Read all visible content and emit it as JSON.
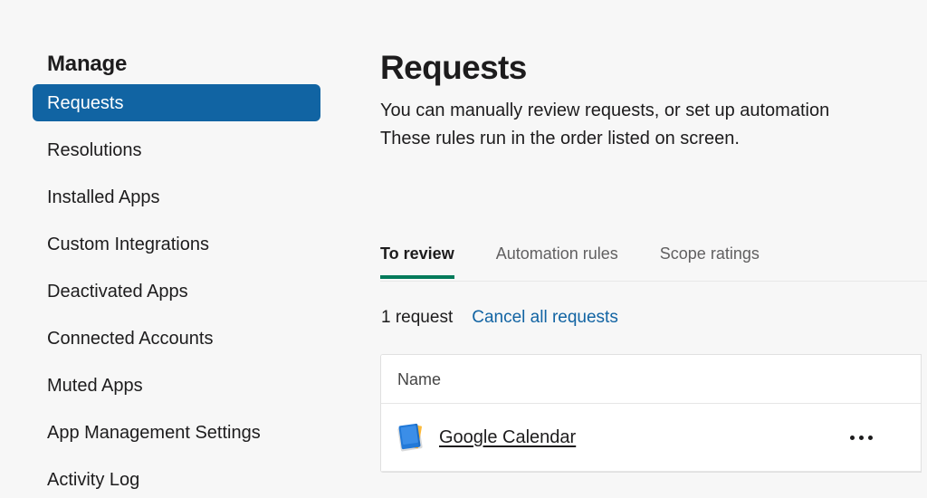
{
  "colors": {
    "page_background": "#f7f7f7",
    "sidebar_selected_background": "#1164a3",
    "sidebar_selected_text": "#ffffff",
    "active_tab_underline": "#007a5a",
    "link_blue": "#1264a3",
    "text_primary": "#1d1c1d",
    "text_muted": "#616061",
    "card_background": "#ffffff",
    "card_border": "#e0e0e0"
  },
  "sidebar": {
    "heading": "Manage",
    "items": [
      {
        "label": "Requests",
        "selected": true
      },
      {
        "label": "Resolutions",
        "selected": false
      },
      {
        "label": "Installed Apps",
        "selected": false
      },
      {
        "label": "Custom Integrations",
        "selected": false
      },
      {
        "label": "Deactivated Apps",
        "selected": false
      },
      {
        "label": "Connected Accounts",
        "selected": false
      },
      {
        "label": "Muted Apps",
        "selected": false
      },
      {
        "label": "App Management Settings",
        "selected": false
      },
      {
        "label": "Activity Log",
        "selected": false
      }
    ]
  },
  "main": {
    "title": "Requests",
    "description_line1": "You can manually review requests, or set up automation",
    "description_line2": "These rules run in the order listed on screen.",
    "tabs": [
      {
        "label": "To review",
        "active": true
      },
      {
        "label": "Automation rules",
        "active": false
      },
      {
        "label": "Scope ratings",
        "active": false
      }
    ],
    "meta": {
      "count_label": "1 request",
      "cancel_all_label": "Cancel all requests"
    },
    "table": {
      "columns": [
        "Name"
      ],
      "rows": [
        {
          "name": "Google Calendar",
          "icon": "google-calendar-icon",
          "overflow_menu": "•••"
        }
      ]
    }
  }
}
